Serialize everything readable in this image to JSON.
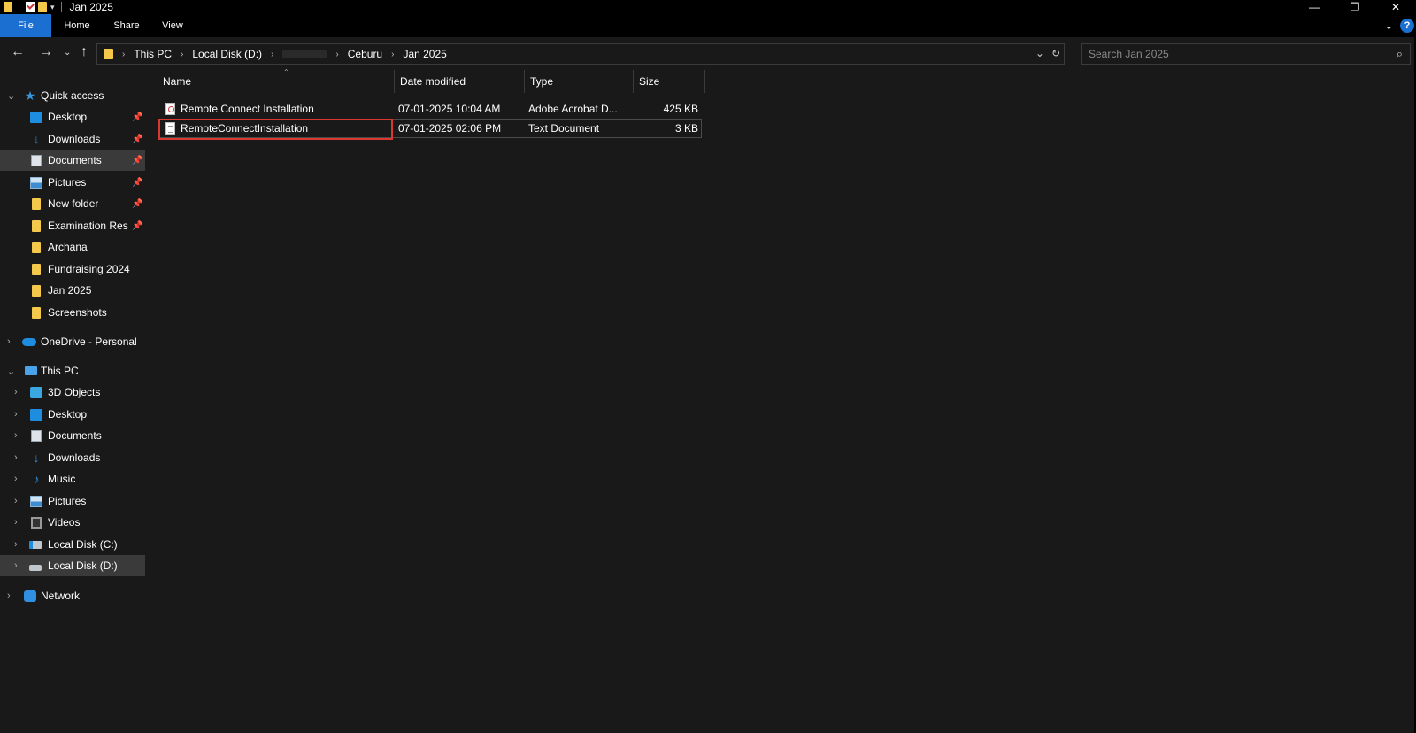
{
  "window": {
    "title": "Jan 2025",
    "controls": {
      "minimize": "—",
      "restore": "❐",
      "close": "✕"
    }
  },
  "ribbon": {
    "tabs": [
      "File",
      "Home",
      "Share",
      "View"
    ],
    "help": "?"
  },
  "nav": {
    "breadcrumbs": [
      "This PC",
      "Local Disk (D:)",
      "Ceburu",
      "Jan 2025"
    ],
    "search_placeholder": "Search Jan 2025"
  },
  "sidebar": {
    "quick_access": {
      "label": "Quick access",
      "items": [
        {
          "label": "Desktop",
          "icon": "desktop-icon",
          "pinned": true
        },
        {
          "label": "Downloads",
          "icon": "downloads-icon",
          "pinned": true
        },
        {
          "label": "Documents",
          "icon": "documents-icon",
          "pinned": true,
          "selected": true
        },
        {
          "label": "Pictures",
          "icon": "pictures-icon",
          "pinned": true
        },
        {
          "label": "New folder",
          "icon": "folder-icon",
          "pinned": true
        },
        {
          "label": "Examination Res",
          "icon": "folder-icon",
          "pinned": true
        },
        {
          "label": "Archana",
          "icon": "folder-icon"
        },
        {
          "label": "Fundraising 2024",
          "icon": "folder-icon"
        },
        {
          "label": "Jan 2025",
          "icon": "folder-icon"
        },
        {
          "label": "Screenshots",
          "icon": "folder-icon"
        }
      ]
    },
    "onedrive": {
      "label": "OneDrive - Personal"
    },
    "this_pc": {
      "label": "This PC",
      "items": [
        {
          "label": "3D Objects",
          "icon": "3d-objects-icon"
        },
        {
          "label": "Desktop",
          "icon": "desktop-icon"
        },
        {
          "label": "Documents",
          "icon": "documents-icon"
        },
        {
          "label": "Downloads",
          "icon": "downloads-icon"
        },
        {
          "label": "Music",
          "icon": "music-icon"
        },
        {
          "label": "Pictures",
          "icon": "pictures-icon"
        },
        {
          "label": "Videos",
          "icon": "videos-icon"
        },
        {
          "label": "Local Disk (C:)",
          "icon": "local-disk-c-icon"
        },
        {
          "label": "Local Disk (D:)",
          "icon": "local-disk-d-icon",
          "selected": true
        }
      ]
    },
    "network": {
      "label": "Network"
    }
  },
  "file_list": {
    "columns": [
      "Name",
      "Date modified",
      "Type",
      "Size"
    ],
    "rows": [
      {
        "name": "Remote Connect Installation",
        "date": "07-01-2025 10:04 AM",
        "type": "Adobe Acrobat D...",
        "size": "425 KB",
        "icon": "pdf-file-icon"
      },
      {
        "name": "RemoteConnectInstallation",
        "date": "07-01-2025 02:06 PM",
        "type": "Text Document",
        "size": "3 KB",
        "icon": "text-file-icon"
      }
    ]
  },
  "colors": {
    "accent": "#1a6fd1",
    "highlight": "#d9372f",
    "folder": "#f4c84b"
  }
}
